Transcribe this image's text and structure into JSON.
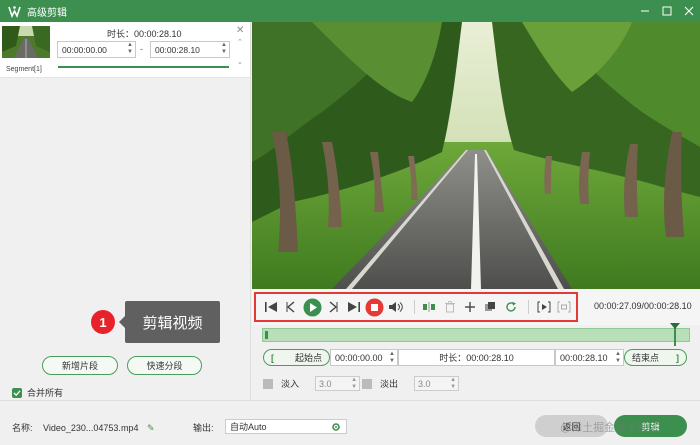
{
  "window": {
    "title": "高级剪辑",
    "minimize_label": "—",
    "maximize_label": "☐",
    "close_label": "✕"
  },
  "segment": {
    "label": "Segment[1]",
    "duration_text": "时长：00:00:28.10",
    "start_time": "00:00:00.00",
    "end_time": "00:00:28.10",
    "separator": "-"
  },
  "left_buttons": {
    "new_segment": "新增片段",
    "quick_split": "快速分段"
  },
  "merge_all": {
    "label": "合并所有",
    "checked": true
  },
  "annotation": {
    "number": "1",
    "text": "剪辑视频"
  },
  "player": {
    "time_readout": "00:00:27.09/00:00:28.10",
    "progress_fraction": 0.964
  },
  "trim": {
    "start_button": "起始点",
    "start_time": "00:00:00.00",
    "duration_text": "时长：00:00:28.10",
    "end_time": "00:00:28.10",
    "end_button": "结束点",
    "left_bracket": "[",
    "right_bracket": "]"
  },
  "fade": {
    "fade_in_label": "淡入",
    "fade_in_value": "3.0",
    "fade_out_label": "淡出",
    "fade_out_value": "3.0"
  },
  "bottom": {
    "name_label": "名称:",
    "file_name": "Video_230...04753.mp4",
    "output_label": "输出:",
    "output_value": "自动Auto",
    "back_button": "返回",
    "cut_button": "剪辑"
  },
  "watermark": "@稀土掘金技术社区",
  "colors": {
    "accent": "#3d8f50",
    "highlight_border": "#e53935",
    "stop_red": "#e53935"
  }
}
